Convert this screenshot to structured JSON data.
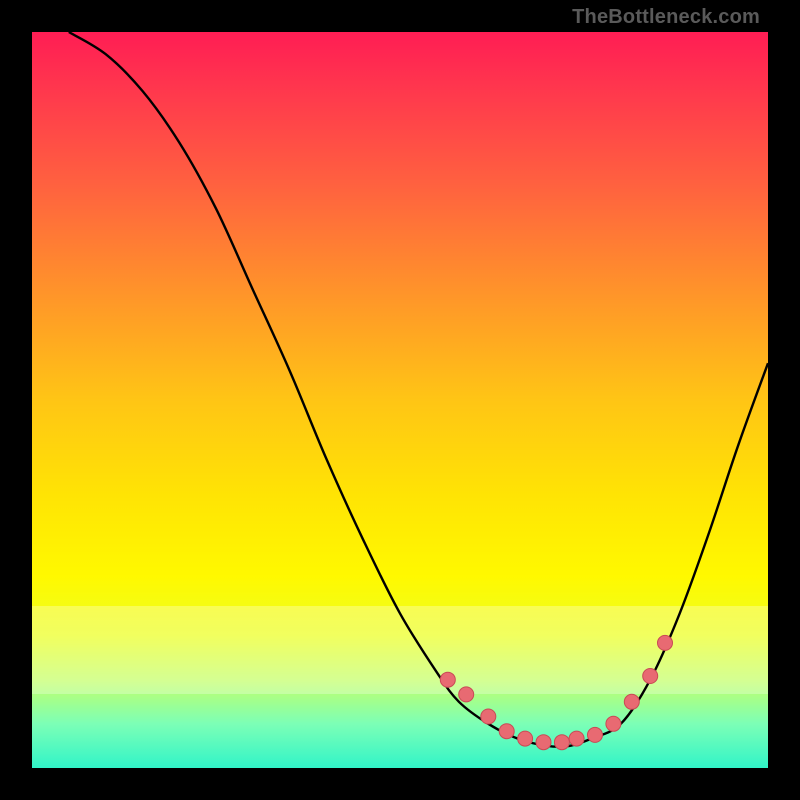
{
  "brand": "TheBottleneck.com",
  "colors": {
    "dot": "#e86a72",
    "dot_stroke": "#c94a55",
    "curve": "#000000"
  },
  "chart_data": {
    "type": "line",
    "title": "",
    "xlabel": "",
    "ylabel": "",
    "xlim": [
      0,
      100
    ],
    "ylim": [
      0,
      100
    ],
    "series": [
      {
        "name": "bottleneck-curve",
        "x": [
          5,
          10,
          15,
          20,
          25,
          30,
          35,
          40,
          45,
          50,
          55,
          58,
          62,
          66,
          70,
          73,
          76,
          80,
          84,
          88,
          92,
          96,
          100
        ],
        "y": [
          100,
          97,
          92,
          85,
          76,
          65,
          54,
          42,
          31,
          21,
          13,
          9,
          6,
          4,
          3,
          3,
          4,
          6,
          12,
          21,
          32,
          44,
          55
        ]
      }
    ],
    "markers": {
      "name": "highlighted-points",
      "x": [
        56.5,
        59,
        62,
        64.5,
        67,
        69.5,
        72,
        74,
        76.5,
        79,
        81.5,
        84,
        86
      ],
      "y": [
        12,
        10,
        7,
        5,
        4,
        3.5,
        3.5,
        4,
        4.5,
        6,
        9,
        12.5,
        17
      ]
    },
    "pale_band_y": [
      10,
      22
    ]
  }
}
